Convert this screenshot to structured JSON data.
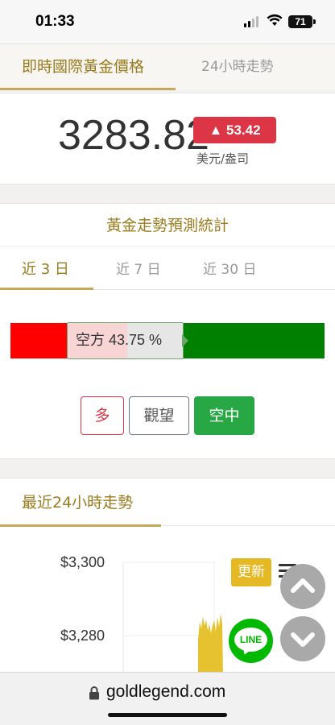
{
  "status_bar": {
    "time": "01:33",
    "battery": "71"
  },
  "price_tabs": [
    {
      "label": "即時國際黃金價格"
    },
    {
      "label": "24小時走勢"
    }
  ],
  "price_panel": {
    "price": "3283.82",
    "change": "▲ 53.42",
    "unit": "美元/盎司",
    "change_color": "#dc3545"
  },
  "forecast": {
    "title": "黃金走勢預測統計",
    "tabs": [
      {
        "label": "近 3 日"
      },
      {
        "label": "近 7 日"
      },
      {
        "label": "近 30 日"
      }
    ],
    "tooltip": "空方 43.75 %",
    "buttons": {
      "long": "多",
      "watch": "觀望",
      "short": "空中"
    },
    "colors": {
      "long": "#ff0000",
      "short": "#008000",
      "accent": "#9a7b1d"
    }
  },
  "trend": {
    "title": "最近24小時走勢",
    "y_ticks": [
      "$3,300",
      "$3,280"
    ]
  },
  "floating": {
    "update_label": "更新",
    "line_label": "LINE"
  },
  "browser": {
    "url": "goldlegend.com"
  }
}
